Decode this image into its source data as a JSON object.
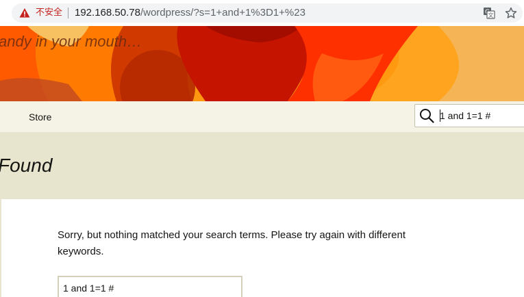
{
  "browser": {
    "security_label": "不安全",
    "url_host": "192.168.50.78",
    "url_path": "/wordpress/?s=1+and+1%3D1+%23",
    "icons": {
      "security": "warning-triangle-icon",
      "translate": "translate-icon",
      "bookmark": "star-icon"
    },
    "colors": {
      "warning": "#c5221f",
      "omnibox_bg": "#f1f3f4"
    }
  },
  "header": {
    "tagline": "andy in your mouth…"
  },
  "nav": {
    "items": [
      {
        "label": "Store"
      }
    ],
    "search": {
      "value": "1 and 1=1 #",
      "icon": "search-icon"
    },
    "colors": {
      "background": "#f5f3e5"
    }
  },
  "archive": {
    "title": "Found",
    "colors": {
      "background": "#e8e5ce"
    }
  },
  "content": {
    "message": "Sorry, but nothing matched your search terms. Please try again with different keywords.",
    "search_value": "1 and 1=1 #"
  }
}
